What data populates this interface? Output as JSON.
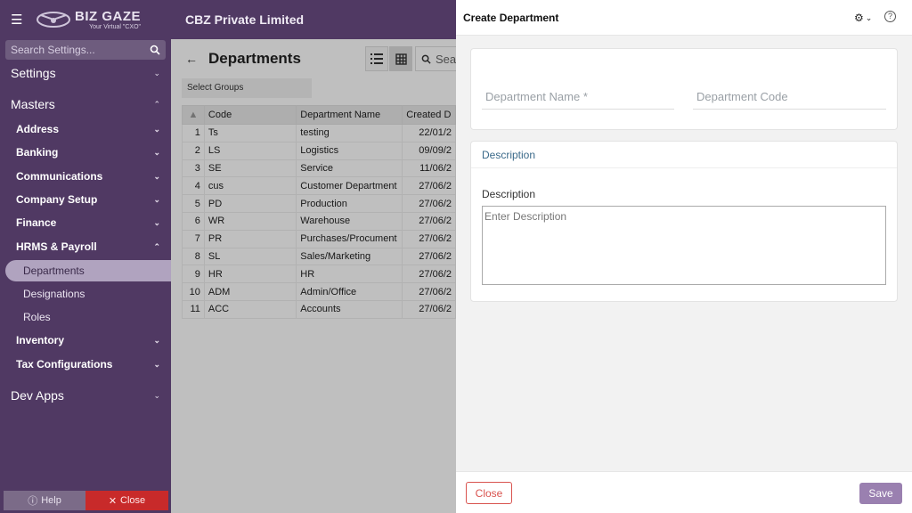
{
  "brand": {
    "name": "BIZ GAZE",
    "tagline": "Your Virtual \"CXO\""
  },
  "sidebar": {
    "search_placeholder": "Search Settings...",
    "settings": "Settings",
    "masters": "Masters",
    "groups": [
      {
        "label": "Address"
      },
      {
        "label": "Banking"
      },
      {
        "label": "Communications"
      },
      {
        "label": "Company Setup"
      },
      {
        "label": "Finance"
      },
      {
        "label": "HRMS & Payroll"
      }
    ],
    "hrms_items": [
      {
        "label": "Departments"
      },
      {
        "label": "Designations"
      },
      {
        "label": "Roles"
      }
    ],
    "after": [
      {
        "label": "Inventory"
      },
      {
        "label": "Tax Configurations"
      }
    ],
    "dev_apps": "Dev Apps",
    "help": "Help",
    "close": "Close"
  },
  "header": {
    "company": "CBZ Private Limited"
  },
  "main": {
    "title": "Departments",
    "search_text": "Sea",
    "select_groups": "Select Groups",
    "columns": [
      "Code",
      "Department Name",
      "Created D"
    ],
    "rows": [
      {
        "n": "1",
        "code": "Ts",
        "name": "testing",
        "created": "22/01/2"
      },
      {
        "n": "2",
        "code": "LS",
        "name": "Logistics",
        "created": "09/09/2"
      },
      {
        "n": "3",
        "code": "SE",
        "name": "Service",
        "created": "11/06/2"
      },
      {
        "n": "4",
        "code": "cus",
        "name": "Customer Department",
        "created": "27/06/2"
      },
      {
        "n": "5",
        "code": "PD",
        "name": "Production",
        "created": "27/06/2"
      },
      {
        "n": "6",
        "code": "WR",
        "name": "Warehouse",
        "created": "27/06/2"
      },
      {
        "n": "7",
        "code": "PR",
        "name": "Purchases/Procument",
        "created": "27/06/2"
      },
      {
        "n": "8",
        "code": "SL",
        "name": "Sales/Marketing",
        "created": "27/06/2"
      },
      {
        "n": "9",
        "code": "HR",
        "name": "HR",
        "created": "27/06/2"
      },
      {
        "n": "10",
        "code": "ADM",
        "name": "Admin/Office",
        "created": "27/06/2"
      },
      {
        "n": "11",
        "code": "ACC",
        "name": "Accounts",
        "created": "27/06/2"
      }
    ]
  },
  "panel": {
    "title": "Create Department",
    "department_name_placeholder": "Department Name *",
    "department_code_placeholder": "Department Code",
    "section_title": "Description",
    "description_label": "Description",
    "description_placeholder": "Enter Description",
    "close_label": "Close",
    "save_label": "Save"
  },
  "colors": {
    "sidebar_bg": "#503963",
    "active_item_bg": "#b0a3bf",
    "save_bg": "#9a80b0",
    "close_red": "#d9534f"
  }
}
